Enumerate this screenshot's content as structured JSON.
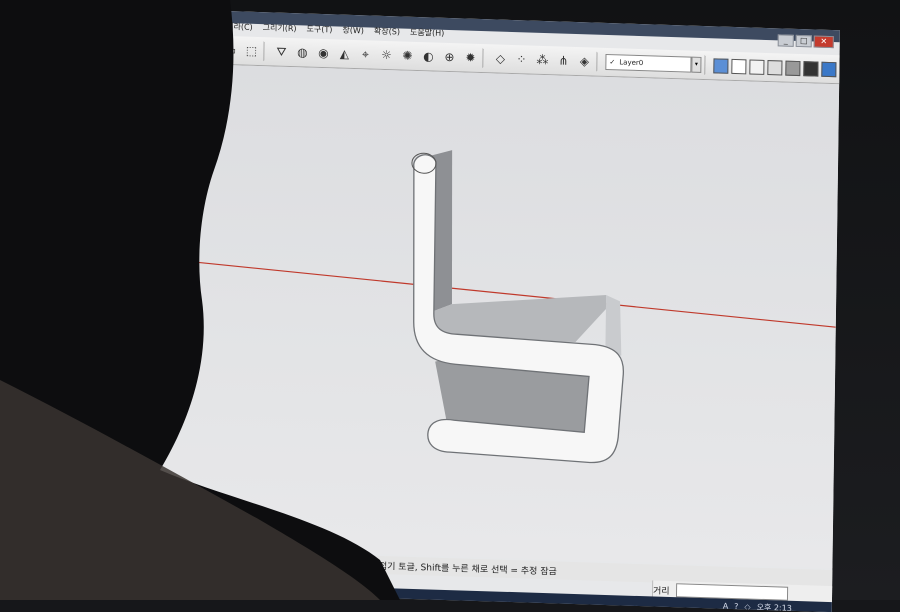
{
  "menu": {
    "items": [
      "카메라(C)",
      "그리기(R)",
      "도구(T)",
      "창(W)",
      "확장(S)",
      "도움말(H)"
    ]
  },
  "window": {
    "minimize": "_",
    "maximize": "□",
    "close": "✕"
  },
  "toolbar": {
    "layer_check": "✓",
    "layer_name": "Layer0",
    "layer_dropdown": "▾"
  },
  "icons": {
    "toolbar": [
      "select-icon",
      "make-component-icon",
      "paint-bucket-icon",
      "eraser-icon",
      "orbit-icon",
      "pan-icon",
      "zoom-icon",
      "zoom-extents-icon",
      "sun-icon",
      "shadow-icon",
      "globe-icon",
      "gear-icon",
      "sandbox-icon",
      "grid-icon",
      "terrain-icon",
      "grass-icon",
      "layers-icon"
    ],
    "styles": [
      "xray-style-icon",
      "wireframe-style-icon",
      "hidden-line-style-icon",
      "shaded-style-icon",
      "textured-style-icon",
      "monochrome-style-icon"
    ],
    "left": [
      "walk-icon",
      "look-around-icon",
      "position-camera-icon",
      "section-icon"
    ]
  },
  "status": {
    "hint": "부시 토글, Alt = 자동 접기 토글, Shift를 누른 채로 선택 = 추정 잠금"
  },
  "measurement": {
    "label": "거리"
  },
  "taskbar": {
    "time": "오후 2:13"
  },
  "colors": {
    "axis_red": "#c0392b",
    "chair_light": "#f7f7f7",
    "chair_shade": "#8e9094",
    "chair_mid": "#b9bbbe",
    "viewport_bg": "#e3e4e6"
  }
}
